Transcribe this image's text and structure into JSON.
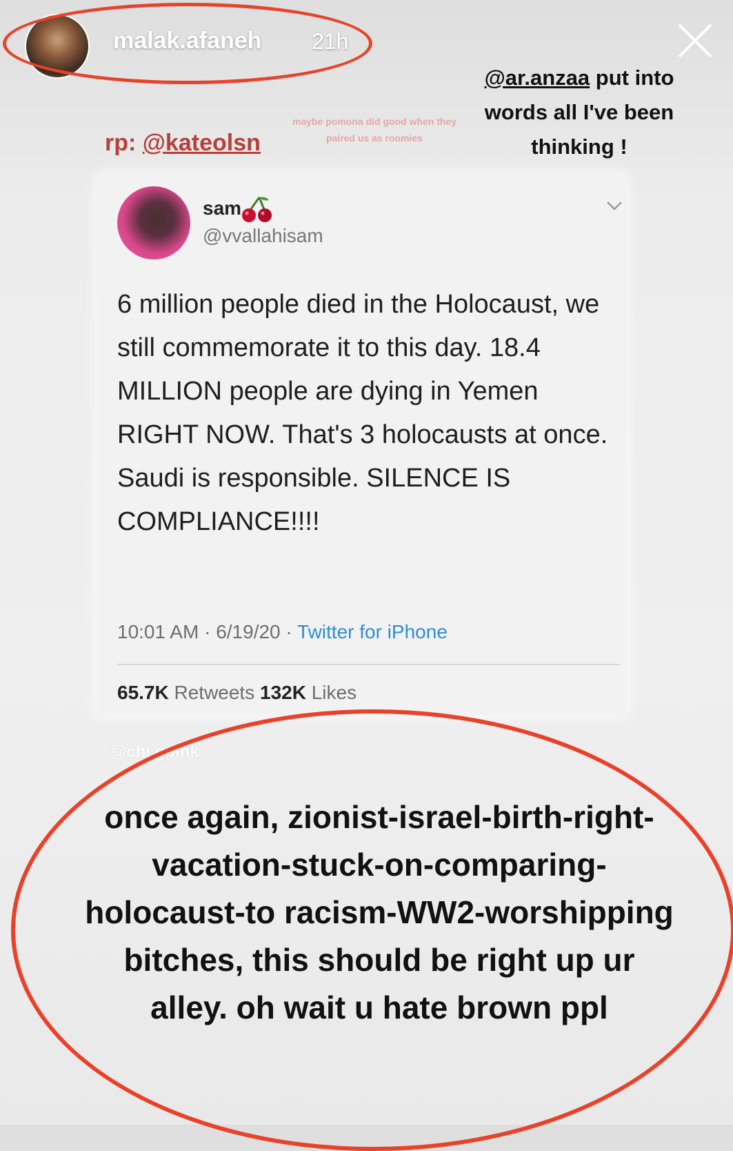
{
  "header": {
    "username": "malak.afaneh",
    "time": "21h",
    "avatar_icon": "profile-avatar",
    "close_icon": "close-icon"
  },
  "caption": {
    "mention": "@ar.anzaa",
    "line1_rest": " put into",
    "line2": "words all I've been",
    "line3": "thinking !"
  },
  "repost": {
    "prefix": "rp: ",
    "mention": "@kateolsn"
  },
  "faint_caption": "maybe pomona did good when they paired us as roomies",
  "tweet": {
    "name": "sam",
    "emoji_icon": "cherry-icon",
    "handle": "@vvallahisam",
    "body": "6 million people died in the Holocaust, we still commemorate it to this day. 18.4 MILLION people are dying in Yemen RIGHT NOW. That's 3 holocausts at once. Saudi is responsible. SILENCE IS COMPLIANCE!!!!",
    "time": "10:01 AM",
    "date": "6/19/20",
    "separator": " · ",
    "source": "Twitter for iPhone",
    "retweets_count": "65.7K",
    "retweets_label": " Retweets ",
    "likes_count": "132K",
    "likes_label": " Likes"
  },
  "watermark": "@chi gpink",
  "bottom_caption": "once again, zionist-israel-birth-right-vacation-stuck-on-comparing-holocaust-to racism-WW2-worshipping bitches, this should be right up ur alley. oh wait u hate brown ppl",
  "colors": {
    "highlight_ring": "#e8432a",
    "repost_red": "#b5403c",
    "link_blue": "#2f8fd0"
  }
}
